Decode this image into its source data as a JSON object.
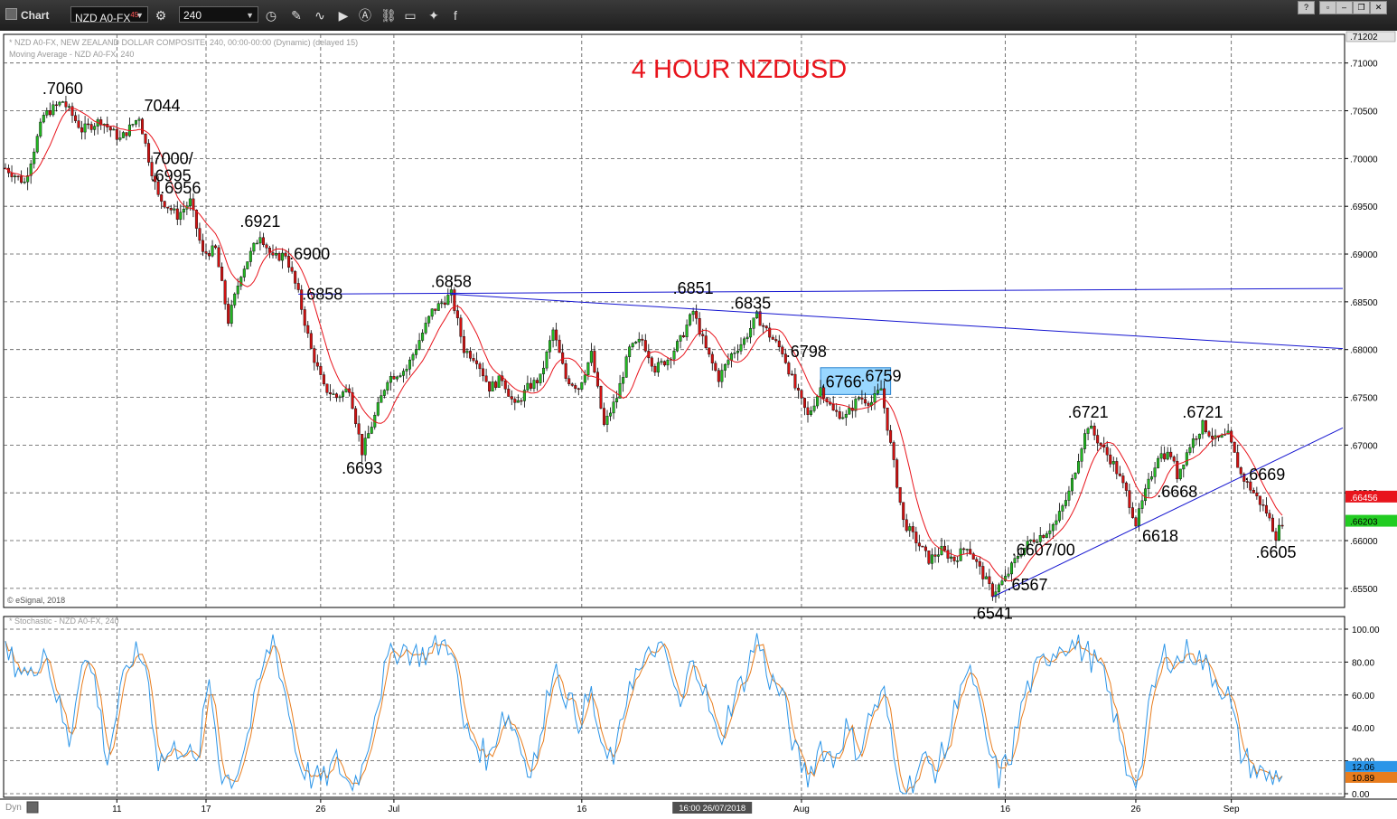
{
  "toolbar": {
    "app_label": "Chart",
    "symbol": "NZD A0-FX",
    "symbol_sup": "45",
    "interval": "240",
    "help": "?",
    "win_min": "–",
    "win_restore": "❐",
    "win_close": "✕"
  },
  "chart_data": {
    "type": "candlestick",
    "title": "4 HOUR NZDUSD",
    "title_color": "#e8141c",
    "info_line1": "* NZD A0-FX, NEW ZEALAND DOLLAR COMPOSITE, 240, 00:00-00:00 (Dynamic) (delayed 15)",
    "info_line2": "Moving Average - NZD A0-FX, 240",
    "copyright": "© eSignal, 2018",
    "stoch_title": "* Stochastic - NZD A0-FX, 240",
    "price_ticks": [
      ".71000",
      ".70500",
      ".70000",
      ".69500",
      ".69000",
      ".68500",
      ".68000",
      ".67500",
      ".67000",
      ".66500",
      ".66000",
      ".65500"
    ],
    "price_top_label": ".71202",
    "last_price": ".66203",
    "last_price_color": "#22cc22",
    "ma_price": ".66456",
    "ma_price_color": "#e8141c",
    "stoch_ticks": [
      "100.00",
      "80.00",
      "60.00",
      "40.00",
      "20.00",
      "0.00"
    ],
    "stoch_k_label": "12.06",
    "stoch_d_label": "10.89",
    "stoch_k_color": "#2b95e8",
    "stoch_d_color": "#e87d1e",
    "date_labels": [
      "11",
      "17",
      "26",
      "Jul",
      "16",
      "Aug",
      "16",
      "26",
      "Sep"
    ],
    "crosshair_label": "16:00 26/07/2018",
    "bottom_left": "Dyn",
    "ylim": [
      0.653,
      0.713
    ],
    "stoch_ylim": [
      0,
      100
    ],
    "up_color": "#22b822",
    "down_color": "#d11111",
    "ma_color": "#e8141c",
    "trendline_color": "#1515d0",
    "path_points": [
      [
        0,
        0.699
      ],
      [
        6,
        0.6975
      ],
      [
        12,
        0.7045
      ],
      [
        18,
        0.706
      ],
      [
        24,
        0.703
      ],
      [
        30,
        0.704
      ],
      [
        36,
        0.702
      ],
      [
        42,
        0.7044
      ],
      [
        45,
        0.7
      ],
      [
        48,
        0.696
      ],
      [
        54,
        0.694
      ],
      [
        58,
        0.6955
      ],
      [
        62,
        0.69
      ],
      [
        66,
        0.6905
      ],
      [
        70,
        0.683
      ],
      [
        74,
        0.688
      ],
      [
        80,
        0.6921
      ],
      [
        84,
        0.6895
      ],
      [
        88,
        0.69
      ],
      [
        92,
        0.6858
      ],
      [
        96,
        0.68
      ],
      [
        100,
        0.676
      ],
      [
        104,
        0.675
      ],
      [
        108,
        0.676
      ],
      [
        112,
        0.6693
      ],
      [
        116,
        0.673
      ],
      [
        120,
        0.677
      ],
      [
        126,
        0.678
      ],
      [
        130,
        0.681
      ],
      [
        134,
        0.684
      ],
      [
        140,
        0.6858
      ],
      [
        144,
        0.68
      ],
      [
        148,
        0.679
      ],
      [
        152,
        0.676
      ],
      [
        156,
        0.677
      ],
      [
        160,
        0.674
      ],
      [
        164,
        0.676
      ],
      [
        168,
        0.677
      ],
      [
        172,
        0.682
      ],
      [
        176,
        0.677
      ],
      [
        180,
        0.676
      ],
      [
        184,
        0.6795
      ],
      [
        188,
        0.672
      ],
      [
        192,
        0.675
      ],
      [
        196,
        0.68
      ],
      [
        200,
        0.681
      ],
      [
        204,
        0.678
      ],
      [
        208,
        0.679
      ],
      [
        212,
        0.681
      ],
      [
        216,
        0.684
      ],
      [
        220,
        0.68
      ],
      [
        224,
        0.677
      ],
      [
        228,
        0.6795
      ],
      [
        232,
        0.681
      ],
      [
        236,
        0.6835
      ],
      [
        240,
        0.6815
      ],
      [
        244,
        0.6798
      ],
      [
        248,
        0.676
      ],
      [
        252,
        0.673
      ],
      [
        256,
        0.676
      ],
      [
        260,
        0.6735
      ],
      [
        264,
        0.673
      ],
      [
        268,
        0.675
      ],
      [
        272,
        0.6745
      ],
      [
        275,
        0.6759
      ],
      [
        278,
        0.67
      ],
      [
        282,
        0.662
      ],
      [
        286,
        0.66
      ],
      [
        290,
        0.658
      ],
      [
        294,
        0.659
      ],
      [
        298,
        0.658
      ],
      [
        302,
        0.6595
      ],
      [
        306,
        0.657
      ],
      [
        310,
        0.6545
      ],
      [
        314,
        0.656
      ],
      [
        318,
        0.6585
      ],
      [
        322,
        0.66
      ],
      [
        326,
        0.6607
      ],
      [
        330,
        0.662
      ],
      [
        334,
        0.665
      ],
      [
        338,
        0.67
      ],
      [
        340,
        0.6721
      ],
      [
        344,
        0.67
      ],
      [
        348,
        0.668
      ],
      [
        352,
        0.665
      ],
      [
        355,
        0.6618
      ],
      [
        358,
        0.665
      ],
      [
        362,
        0.669
      ],
      [
        366,
        0.669
      ],
      [
        368,
        0.6668
      ],
      [
        372,
        0.67
      ],
      [
        376,
        0.6721
      ],
      [
        380,
        0.6705
      ],
      [
        384,
        0.671
      ],
      [
        388,
        0.6669
      ],
      [
        392,
        0.665
      ],
      [
        396,
        0.663
      ],
      [
        399,
        0.6605
      ],
      [
        401,
        0.662
      ]
    ],
    "stoch_points": [
      [
        0,
        85
      ],
      [
        4,
        78
      ],
      [
        8,
        70
      ],
      [
        12,
        90
      ],
      [
        16,
        60
      ],
      [
        20,
        30
      ],
      [
        24,
        85
      ],
      [
        28,
        70
      ],
      [
        32,
        20
      ],
      [
        36,
        60
      ],
      [
        40,
        85
      ],
      [
        44,
        80
      ],
      [
        48,
        20
      ],
      [
        52,
        25
      ],
      [
        56,
        30
      ],
      [
        60,
        15
      ],
      [
        64,
        70
      ],
      [
        68,
        10
      ],
      [
        72,
        10
      ],
      [
        76,
        35
      ],
      [
        80,
        70
      ],
      [
        84,
        95
      ],
      [
        88,
        60
      ],
      [
        92,
        20
      ],
      [
        96,
        10
      ],
      [
        100,
        8
      ],
      [
        104,
        20
      ],
      [
        108,
        5
      ],
      [
        112,
        15
      ],
      [
        116,
        50
      ],
      [
        120,
        80
      ],
      [
        124,
        90
      ],
      [
        128,
        85
      ],
      [
        132,
        85
      ],
      [
        136,
        90
      ],
      [
        140,
        92
      ],
      [
        144,
        40
      ],
      [
        148,
        30
      ],
      [
        152,
        20
      ],
      [
        156,
        50
      ],
      [
        160,
        40
      ],
      [
        164,
        15
      ],
      [
        168,
        30
      ],
      [
        172,
        80
      ],
      [
        176,
        60
      ],
      [
        180,
        45
      ],
      [
        184,
        60
      ],
      [
        188,
        20
      ],
      [
        192,
        25
      ],
      [
        196,
        70
      ],
      [
        200,
        75
      ],
      [
        204,
        90
      ],
      [
        208,
        80
      ],
      [
        212,
        50
      ],
      [
        216,
        85
      ],
      [
        220,
        60
      ],
      [
        224,
        30
      ],
      [
        228,
        55
      ],
      [
        232,
        70
      ],
      [
        236,
        95
      ],
      [
        240,
        70
      ],
      [
        244,
        60
      ],
      [
        248,
        25
      ],
      [
        252,
        10
      ],
      [
        256,
        30
      ],
      [
        260,
        20
      ],
      [
        264,
        40
      ],
      [
        268,
        25
      ],
      [
        272,
        50
      ],
      [
        276,
        60
      ],
      [
        280,
        10
      ],
      [
        284,
        5
      ],
      [
        288,
        20
      ],
      [
        292,
        15
      ],
      [
        296,
        30
      ],
      [
        300,
        70
      ],
      [
        304,
        70
      ],
      [
        308,
        30
      ],
      [
        312,
        10
      ],
      [
        316,
        25
      ],
      [
        320,
        60
      ],
      [
        324,
        75
      ],
      [
        328,
        85
      ],
      [
        332,
        92
      ],
      [
        336,
        90
      ],
      [
        340,
        85
      ],
      [
        344,
        75
      ],
      [
        348,
        50
      ],
      [
        352,
        15
      ],
      [
        356,
        10
      ],
      [
        360,
        60
      ],
      [
        364,
        85
      ],
      [
        368,
        80
      ],
      [
        372,
        88
      ],
      [
        376,
        80
      ],
      [
        380,
        70
      ],
      [
        384,
        60
      ],
      [
        388,
        25
      ],
      [
        392,
        15
      ],
      [
        396,
        10
      ],
      [
        400,
        12
      ]
    ],
    "annotations": [
      {
        "text": ".7060",
        "x": 18,
        "y": 0.706,
        "pos": "above"
      },
      {
        "text": "7044",
        "x": 43,
        "y": 0.7044,
        "pos": "above-right"
      },
      {
        "text": "7000/",
        "x": 45,
        "y": 0.7,
        "pos": "right"
      },
      {
        "text": ".6995",
        "x": 45,
        "y": 0.6995,
        "pos": "below-right"
      },
      {
        "text": ".6956",
        "x": 55,
        "y": 0.6956,
        "pos": "above"
      },
      {
        "text": ".6921",
        "x": 80,
        "y": 0.6921,
        "pos": "above"
      },
      {
        "text": ".6900",
        "x": 88,
        "y": 0.69,
        "pos": "right"
      },
      {
        "text": ".6858",
        "x": 92,
        "y": 0.6858,
        "pos": "right"
      },
      {
        "text": ".6693",
        "x": 112,
        "y": 0.6693,
        "pos": "below"
      },
      {
        "text": ".6858",
        "x": 140,
        "y": 0.6858,
        "pos": "above"
      },
      {
        "text": ".6851",
        "x": 216,
        "y": 0.6851,
        "pos": "above"
      },
      {
        "text": ".6835",
        "x": 234,
        "y": 0.6835,
        "pos": "above"
      },
      {
        "text": ".6798",
        "x": 244,
        "y": 0.6798,
        "pos": "right"
      },
      {
        "text": ".6766",
        "x": 255,
        "y": 0.6766,
        "pos": "right"
      },
      {
        "text": ".6759",
        "x": 275,
        "y": 0.6759,
        "pos": "above"
      },
      {
        "text": ".6721",
        "x": 340,
        "y": 0.6721,
        "pos": "above"
      },
      {
        "text": ".6721",
        "x": 376,
        "y": 0.6721,
        "pos": "above"
      },
      {
        "text": ".6669",
        "x": 388,
        "y": 0.6669,
        "pos": "right"
      },
      {
        "text": ".6668",
        "x": 368,
        "y": 0.6668,
        "pos": "below"
      },
      {
        "text": ".6618",
        "x": 355,
        "y": 0.6618,
        "pos": "below-right"
      },
      {
        "text": ".6607/00",
        "x": 326,
        "y": 0.6607,
        "pos": "below"
      },
      {
        "text": ".6567",
        "x": 314,
        "y": 0.6567,
        "pos": "below-right"
      },
      {
        "text": ".6541",
        "x": 310,
        "y": 0.6541,
        "pos": "below"
      },
      {
        "text": ".6605",
        "x": 399,
        "y": 0.6605,
        "pos": "below"
      }
    ],
    "trendlines": [
      {
        "x1": 92,
        "y1": 0.6858,
        "x2": 420,
        "y2": 0.6864
      },
      {
        "x1": 140,
        "y1": 0.6858,
        "x2": 420,
        "y2": 0.6801
      },
      {
        "x1": 310,
        "y1": 0.6541,
        "x2": 420,
        "y2": 0.6718
      }
    ],
    "zone": {
      "x1": 256,
      "x2": 278,
      "y1": 0.6753,
      "y2": 0.6781,
      "color": "#6ec6ff"
    },
    "grid": true
  }
}
